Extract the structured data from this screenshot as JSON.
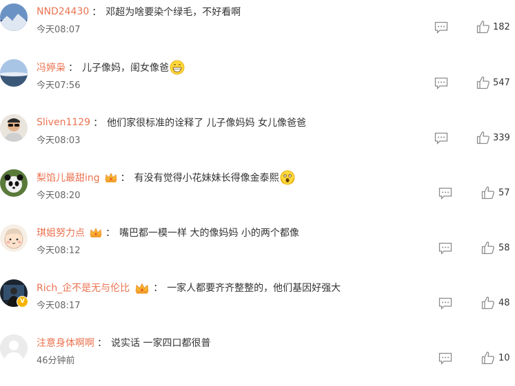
{
  "comments": [
    {
      "user": "NND24430",
      "text": "邓超为啥要染个绿毛，不好看啊",
      "time": "今天08:07",
      "likes": "182",
      "avatar": "avatar-landscape-icon",
      "badge": null,
      "emoji": null
    },
    {
      "user": "冯婷枭",
      "text": "儿子像妈，闺女像爸",
      "time": "今天07:56",
      "likes": "547",
      "avatar": "avatar-sky-icon",
      "badge": null,
      "emoji": "grin-emoji-icon"
    },
    {
      "user": "Sliven1129",
      "text": "他们家很标准的诠释了 儿子像妈妈 女儿像爸爸",
      "time": "今天08:03",
      "likes": "339",
      "avatar": "avatar-person-sunglasses-icon",
      "badge": null,
      "emoji": null
    },
    {
      "user": "梨馅儿最甜ing",
      "text": "有没有觉得小花妹妹长得像金泰熙",
      "time": "今天08:20",
      "likes": "57",
      "avatar": "avatar-panda-icon",
      "badge": "crown-badge-icon",
      "emoji": "shocked-emoji-icon"
    },
    {
      "user": "琪姐努力点",
      "text": "嘴巴都一模一样 大的像妈妈 小的两个都像",
      "time": "今天08:12",
      "likes": "58",
      "avatar": "avatar-cartoon-face-icon",
      "badge": "crown-badge-icon",
      "emoji": null
    },
    {
      "user": "Rich_企不是无与伦比",
      "text": "一家人都要齐齐整整的，他们基因好强大",
      "time": "今天08:17",
      "likes": "48",
      "avatar": "avatar-dark-photo-icon",
      "badge": "crown-badge-icon",
      "emoji": null,
      "verified": "V"
    },
    {
      "user": "注意身体啊啊",
      "text": "说实话 一家四口都很普",
      "time": "46分钟前",
      "likes": "10",
      "avatar": "avatar-default-icon",
      "badge": null,
      "emoji": null
    }
  ],
  "separator": "：",
  "colors": {
    "username": "#eb7350",
    "text": "#333333",
    "time": "#666666",
    "icon": "#8a8a8a",
    "badge": "#f5b400"
  }
}
